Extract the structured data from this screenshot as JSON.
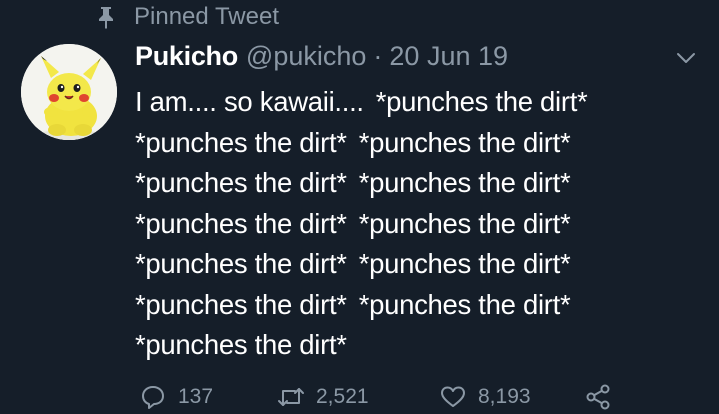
{
  "pinned": {
    "label": "Pinned Tweet",
    "icon": "pin-icon"
  },
  "tweet": {
    "display_name": "Pukicho",
    "handle": "@pukicho",
    "separator": "·",
    "date": "20 Jun 19",
    "lines": [
      [
        "I am.... so kawaii....",
        "*punches the dirt*"
      ],
      [
        "*punches the dirt*",
        "*punches the dirt*"
      ],
      [
        "*punches the dirt*",
        "*punches the dirt*"
      ],
      [
        "*punches the dirt*",
        "*punches the dirt*"
      ],
      [
        "*punches the dirt*",
        "*punches the dirt*"
      ],
      [
        "*punches the dirt*",
        "*punches the dirt*"
      ],
      [
        "*punches the dirt*"
      ]
    ]
  },
  "actions": {
    "replies": "137",
    "retweets": "2,521",
    "likes": "8,193"
  },
  "colors": {
    "background": "#151e29",
    "text": "#ffffff",
    "muted": "#8b98a5"
  }
}
